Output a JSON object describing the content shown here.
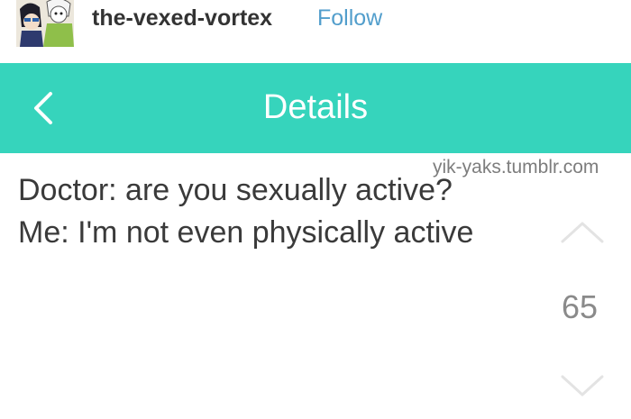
{
  "post": {
    "username": "the-vexed-vortex",
    "follow_label": "Follow",
    "avatar_icon": "avatar-image"
  },
  "app_bar": {
    "title": "Details",
    "back_icon": "chevron-left-icon",
    "color": "#36d4bc"
  },
  "yak": {
    "line1": "Doctor: are you sexually active?",
    "line2": "Me: I'm not even physically active",
    "watermark": "yik-yaks.tumblr.com",
    "vote_count": "65",
    "upvote_icon": "chevron-up-icon",
    "downvote_icon": "chevron-down-icon"
  }
}
